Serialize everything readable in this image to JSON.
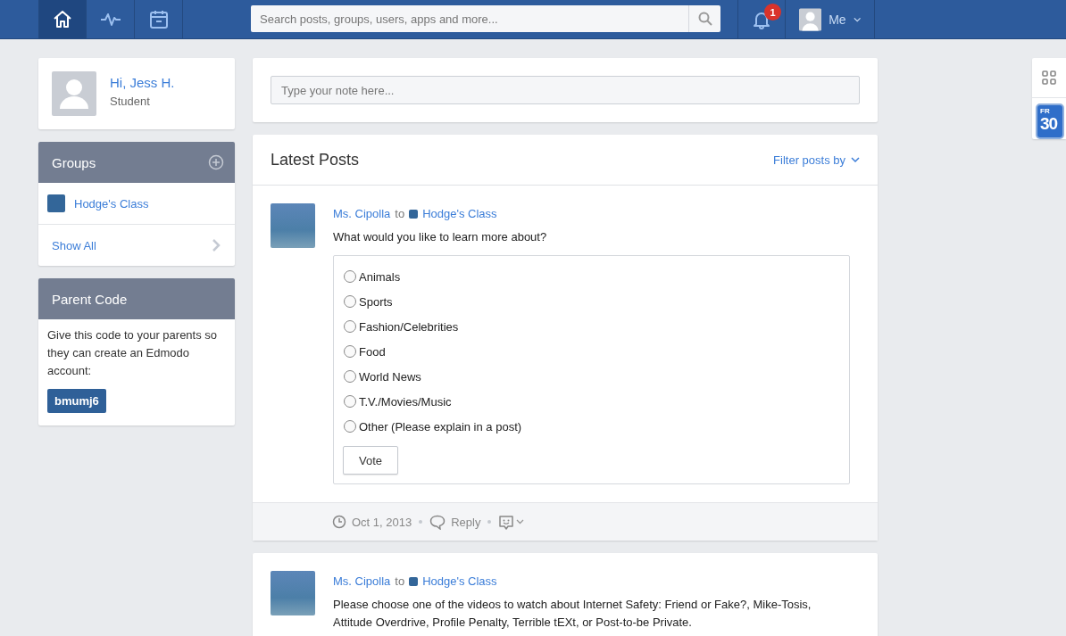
{
  "nav": {
    "tabs": [
      {
        "kind": "home",
        "selected": true
      },
      {
        "kind": "activity",
        "selected": false
      },
      {
        "kind": "planner",
        "selected": false
      }
    ],
    "search": {
      "placeholder": "Search posts, groups, users, apps and more..."
    },
    "notifications": {
      "count": "1"
    },
    "account": {
      "label": "Me"
    }
  },
  "profile": {
    "greeting": "Hi, Jess H.",
    "role": "Student"
  },
  "groups": {
    "title": "Groups",
    "items": [
      {
        "name": "Hodge's Class",
        "color": "#336699"
      }
    ],
    "show_all": "Show All"
  },
  "parent_code": {
    "title": "Parent Code",
    "text": "Give this code to your parents so they can create an Edmodo account:",
    "code": "bmumj6"
  },
  "note": {
    "placeholder": "Type your note here..."
  },
  "feed": {
    "title": "Latest Posts",
    "filter": "Filter posts by",
    "posts": [
      {
        "author": "Ms. Cipolla",
        "to": "to",
        "group": {
          "name": "Hodge's Class",
          "color": "#336699"
        },
        "text": "What would you like to learn more about?",
        "poll": {
          "options": [
            {
              "label": "Animals",
              "selected": false
            },
            {
              "label": "Sports",
              "selected": false
            },
            {
              "label": "Fashion/Celebrities",
              "selected": false
            },
            {
              "label": "Food",
              "selected": false
            },
            {
              "label": "World News",
              "selected": false
            },
            {
              "label": "T.V./Movies/Music",
              "selected": false
            },
            {
              "label": "Other (Please explain in a post)",
              "selected": false
            }
          ],
          "button": "Vote"
        },
        "date": "Oct 1, 2013",
        "reply": "Reply"
      },
      {
        "author": "Ms. Cipolla",
        "to": "to",
        "group": {
          "name": "Hodge's Class",
          "color": "#336699"
        },
        "text": "Please choose one of the videos to watch about Internet Safety: Friend or Fake?, Mike-Tosis, Attitude Overdrive, Profile Penalty, Terrible tEXt, or Post-to-be Private."
      }
    ]
  },
  "side_widget": {
    "calendar_day": "FR",
    "calendar_date": "30"
  }
}
